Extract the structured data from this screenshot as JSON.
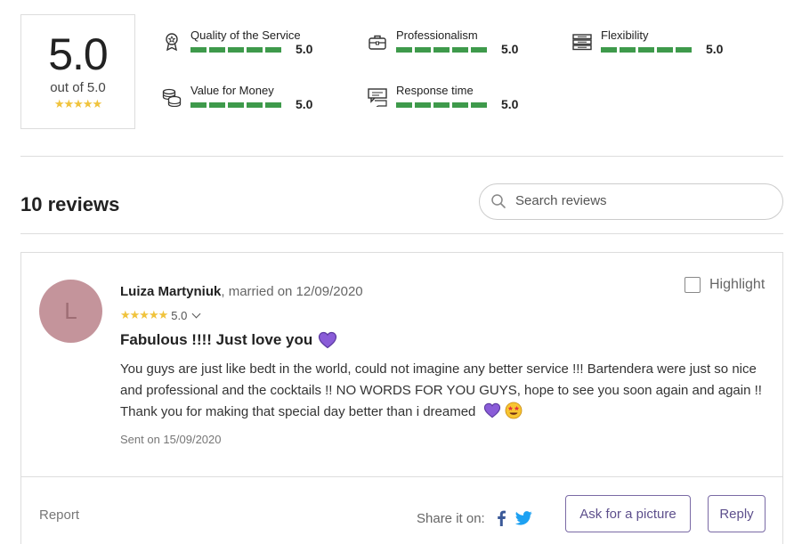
{
  "summary": {
    "score": "5.0",
    "out_of": "out of 5.0",
    "stars": "★★★★★"
  },
  "categories": [
    {
      "label": "Quality of the Service",
      "value": "5.0",
      "icon": "award-icon",
      "rating": 1.0
    },
    {
      "label": "Professionalism",
      "value": "5.0",
      "icon": "briefcase-icon",
      "rating": 1.0
    },
    {
      "label": "Flexibility",
      "value": "5.0",
      "icon": "stack-icon",
      "rating": 1.0
    },
    {
      "label": "Value for Money",
      "value": "5.0",
      "icon": "coins-icon",
      "rating": 1.0
    },
    {
      "label": "Response time",
      "value": "5.0",
      "icon": "chat-icon",
      "rating": 1.0
    }
  ],
  "reviews_header": {
    "count_label": "10 reviews",
    "search_placeholder": "Search reviews"
  },
  "review": {
    "avatar_letter": "L",
    "author": "Luiza Martyniuk",
    "married_on": ", married on 12/09/2020",
    "stars": "★★★★★",
    "rating": "5.0",
    "title": "Fabulous !!!! Just love you",
    "body": "You guys are just like bedt in the world, could not imagine any better service !!! Bartendera were just so nice and professional and the cocktails !! NO WORDS FOR YOU GUYS, hope to see you soon again and again !! Thank you for making that special day better than i dreamed",
    "sent": "Sent on 15/09/2020",
    "highlight_label": "Highlight",
    "report_label": "Report",
    "share_label": "Share it on:",
    "ask_picture_label": "Ask for a picture",
    "reply_label": "Reply"
  },
  "colors": {
    "rating_green": "#3e9a4b",
    "star_yellow": "#f0c33c",
    "avatar_bg": "#c4949b",
    "button_purple": "#5d4f8c",
    "heart_purple": "#8a5cd8",
    "facebook_blue": "#3b5998",
    "twitter_blue": "#1da1f2"
  }
}
